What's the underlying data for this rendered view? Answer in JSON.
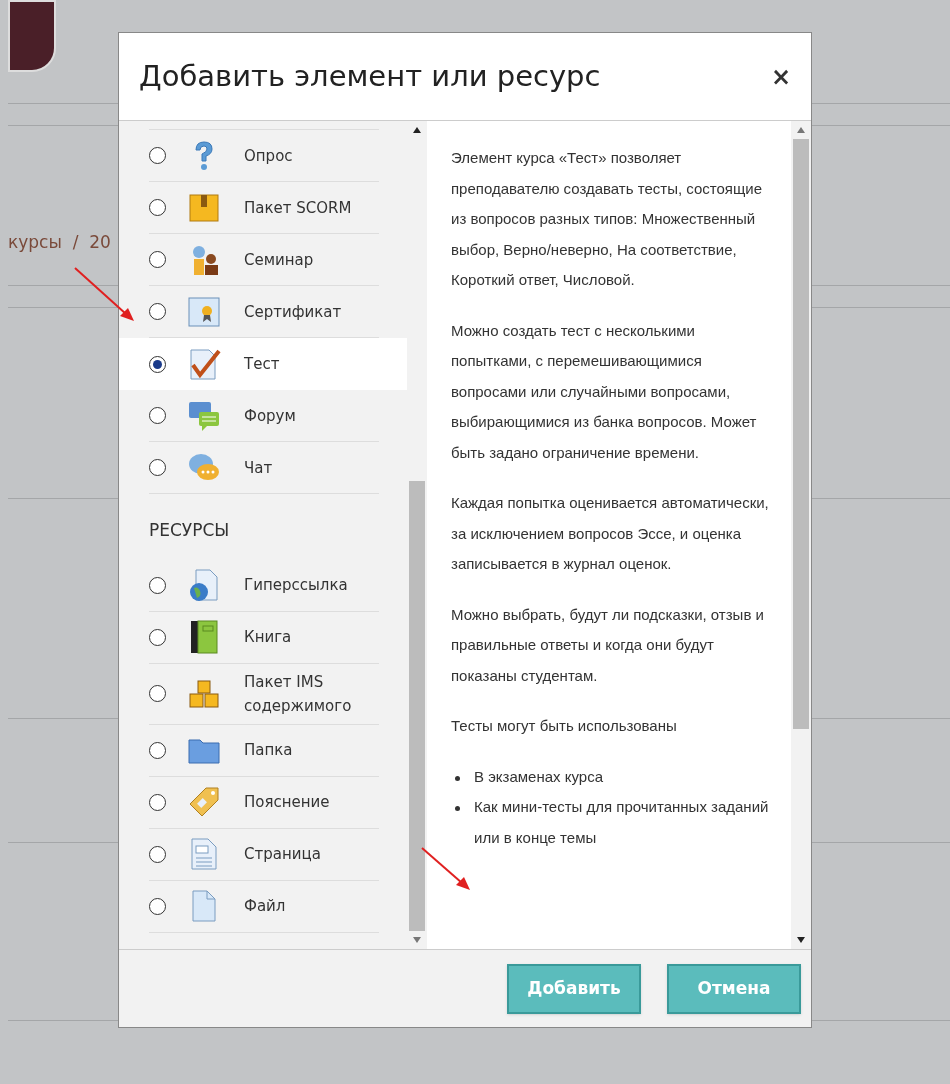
{
  "breadcrumb": {
    "text": "курсы  /  20"
  },
  "dialog": {
    "title": "Добавить элемент или ресурс",
    "close": "×",
    "groups": [
      {
        "items": [
          {
            "label": "Опрос",
            "selected": false
          },
          {
            "label": "Пакет SCORM",
            "selected": false
          },
          {
            "label": "Семинар",
            "selected": false
          },
          {
            "label": "Сертификат",
            "selected": false
          },
          {
            "label": "Тест",
            "selected": true
          },
          {
            "label": "Форум",
            "selected": false
          },
          {
            "label": "Чат",
            "selected": false
          }
        ]
      },
      {
        "heading": "РЕСУРСЫ",
        "items": [
          {
            "label": "Гиперссылка",
            "selected": false
          },
          {
            "label": "Книга",
            "selected": false
          },
          {
            "label": "Пакет IMS содержимого",
            "selected": false
          },
          {
            "label": "Папка",
            "selected": false
          },
          {
            "label": "Пояснение",
            "selected": false
          },
          {
            "label": "Страница",
            "selected": false
          },
          {
            "label": "Файл",
            "selected": false
          }
        ]
      }
    ],
    "description": {
      "paragraphs": [
        "Элемент курса «Тест» позволяет преподавателю создавать тесты, состоящие из вопросов разных типов: Множественный выбор, Верно/неверно, На соответствие, Короткий ответ, Числовой.",
        "Можно создать тест с несколькими попытками, с перемешивающимися вопросами или случайными вопросами, выбирающимися из банка вопросов. Может быть задано ограничение времени.",
        "Каждая попытка оценивается автоматически, за исключением вопросов Эссе, и оценка записывается в журнал оценок.",
        "Можно выбрать, будут ли подсказки, отзыв и правильные ответы и когда они будут показаны студентам.",
        "Тесты могут быть использованы"
      ],
      "bullets": [
        "В экзаменах курса",
        "Как мини-тесты для прочитанных заданий или в конце темы"
      ]
    },
    "buttons": [
      "Добавить",
      "Отмена"
    ]
  }
}
